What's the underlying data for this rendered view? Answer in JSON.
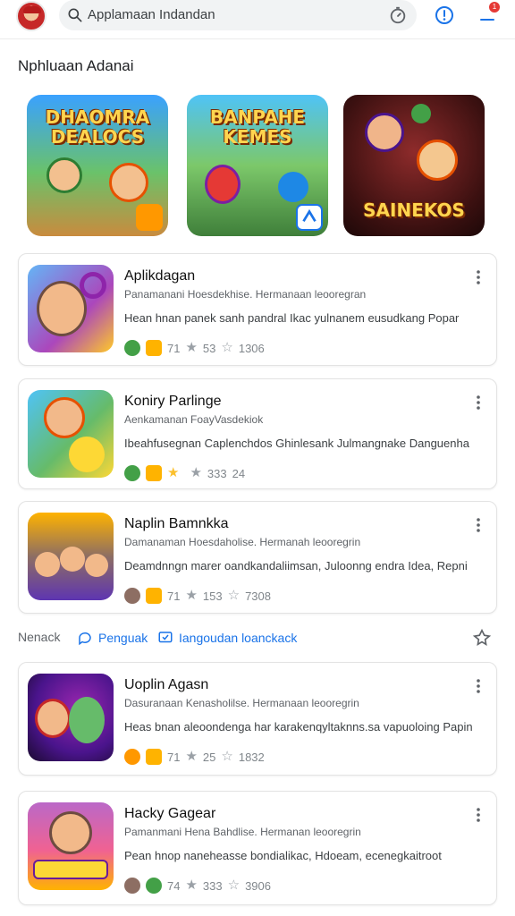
{
  "header": {
    "search_text": "Applamaan Indandan",
    "notification_count": "1"
  },
  "section": {
    "title": "Nphluaan Adanai"
  },
  "featured": [
    {
      "title": "DHAOMRA DEALOCS"
    },
    {
      "title": "BANPAHE KEMES"
    },
    {
      "title": "SAINEKOS"
    }
  ],
  "apps": [
    {
      "title": "Aplikdagan",
      "subtitle": "Panamanani Hoesdekhise. Hermanaan leooregran",
      "description": "Hean hnan panek sanh pandral Ikac yulnanem eusudkang Popar",
      "rating": "71",
      "stat2": "53",
      "stat3": "1306"
    },
    {
      "title": "Koniry Parlinge",
      "subtitle": "Aenkamanan FoayVasdekiok",
      "description": "Ibeahfusegnan Caplenchdos Ghinlesank Julmangnake Danguenha",
      "rating": "",
      "stat2": "333",
      "stat3": "24"
    },
    {
      "title": "Naplin Bamnkka",
      "subtitle": "Damanaman Hoesdaholise. Hermanah leooregrin",
      "description": "Deamdnngn marer oandkandaliimsan, Juloonng endra Idea, Repni",
      "rating": "71",
      "stat2": "153",
      "stat3": "7308"
    }
  ],
  "filters": {
    "label": "Nenack",
    "chip1": "Penguak",
    "chip2": "Iangoudan loanckack"
  },
  "apps2": [
    {
      "title": "Uoplin Agasn",
      "subtitle": "Dasuranaan Kenasholilse. Hermanaan leooregrin",
      "description": "Heas bnan aleoondenga har karakenqyltaknns.sa vapuoloing Papin",
      "rating": "71",
      "stat2": "25",
      "stat3": "1832"
    },
    {
      "title": "Hacky Gagear",
      "subtitle": "Pamanmani Hena Bahdlise. Hermanan leooregrin",
      "description": "Pean hnop naneheasse bondialikac, Hdoeam, ecenegkaitroot",
      "rating": "74",
      "stat2": "333",
      "stat3": "3906"
    }
  ]
}
